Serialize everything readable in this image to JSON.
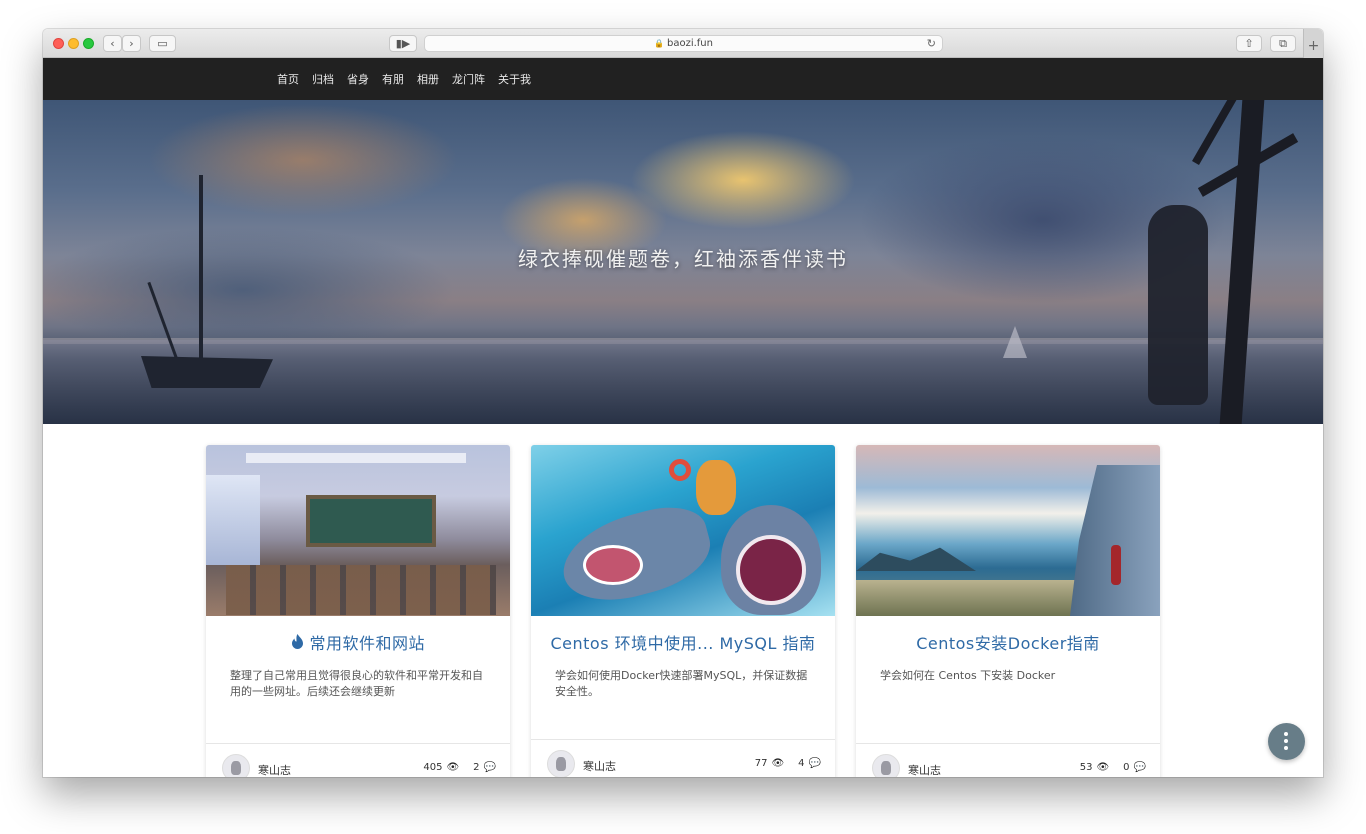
{
  "browser": {
    "url": "baozi.fun"
  },
  "nav": {
    "items": [
      "首页",
      "归档",
      "省身",
      "有朋",
      "相册",
      "龙门阵",
      "关于我"
    ]
  },
  "hero": {
    "title": "绿衣捧砚催题卷，红袖添香伴读书"
  },
  "cards": [
    {
      "title": "常用软件和网站",
      "pinned_icon": "fire-icon",
      "description": "整理了自己常用且觉得很良心的软件和平常开发和自用的一些网址。后续还会继续更新",
      "author": "寒山志",
      "views": "405",
      "comments": "2"
    },
    {
      "title": "Centos 环境中使用... MySQL 指南",
      "description": "学会如何使用Docker快速部署MySQL，并保证数据安全性。",
      "author": "寒山志",
      "views": "77",
      "comments": "4"
    },
    {
      "title": "Centos安装Docker指南",
      "description": "学会如何在 Centos 下安装 Docker",
      "author": "寒山志",
      "views": "53",
      "comments": "0"
    }
  ],
  "colors": {
    "navbar": "#212121",
    "link": "#2f6aa6",
    "fab": "#677d88"
  }
}
